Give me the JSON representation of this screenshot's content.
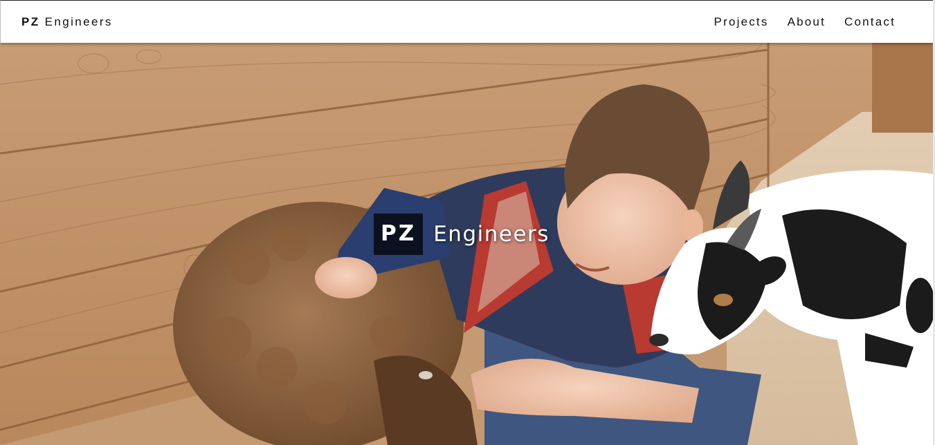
{
  "navbar": {
    "brand_bold": "PZ",
    "brand_rest": " Engineers",
    "links": [
      "Projects",
      "About",
      "Contact"
    ]
  },
  "hero": {
    "badge": "PZ",
    "title": "Engineers",
    "image_subject": "boy hugging a sheep and a goat by a wooden fence"
  },
  "colors": {
    "navbar_bg": "#ffffff",
    "badge_bg": "#1a1a1a",
    "wood": "#c49a72",
    "text": "#111111"
  }
}
